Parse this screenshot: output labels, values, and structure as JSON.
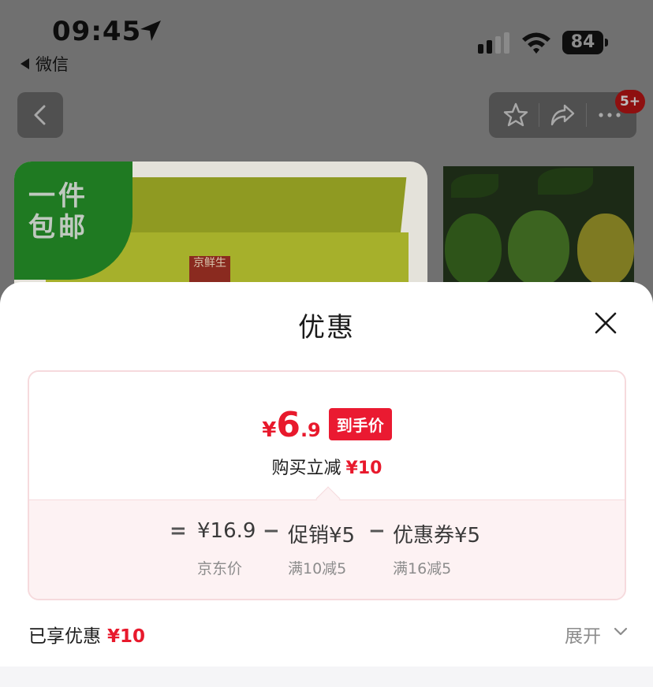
{
  "status_bar": {
    "time": "09:45",
    "back_app": "微信",
    "battery": "84"
  },
  "nav": {
    "cart_badge": "5+"
  },
  "product_image": {
    "ribbon_line1": "一件",
    "ribbon_line2": "包邮",
    "brand_label": "京鲜生"
  },
  "sheet": {
    "title": "优惠",
    "price_currency": "¥",
    "price_integer": "6",
    "price_decimal": ".9",
    "price_tag": "到手价",
    "reduce_text": "购买立减",
    "reduce_amount": "¥10",
    "breakdown": {
      "equals": "=",
      "base_price": "¥16.9",
      "minus1": "−",
      "promo": "促销¥5",
      "minus2": "−",
      "coupon": "优惠券¥5",
      "base_label": "京东价",
      "promo_label": "满10减5",
      "coupon_label": "满16减5"
    },
    "enjoyed_label": "已享优惠",
    "enjoyed_amount": "¥10",
    "expand_label": "展开"
  },
  "colors": {
    "accent": "#e8192c",
    "card_border": "#f6dadd",
    "card_bottom_bg": "#fdf2f3"
  }
}
